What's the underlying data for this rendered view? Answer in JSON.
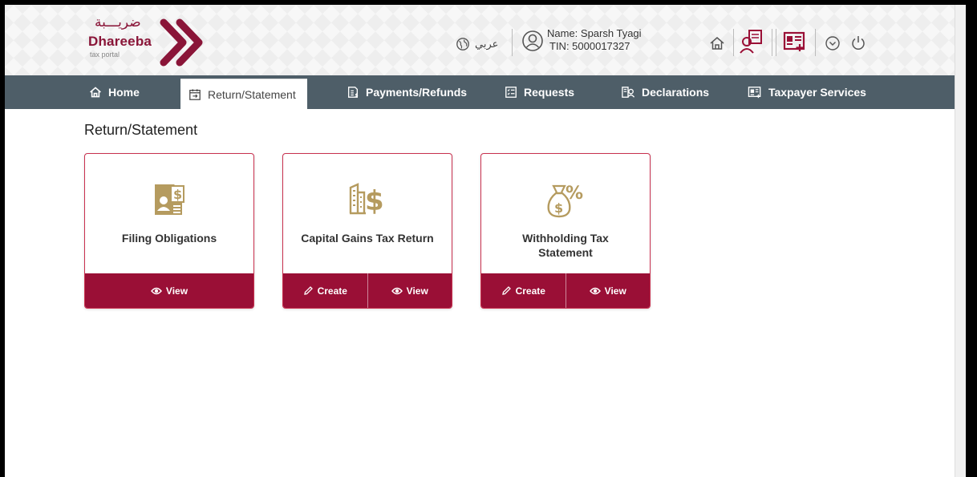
{
  "header": {
    "logo_arabic": "ضريـــبة",
    "logo_name": "Dhareeba",
    "logo_sub": "tax portal",
    "language": "عربي",
    "user_name": "Name: Sparsh Tyagi",
    "user_tin": "TIN: 5000017327",
    "icons": [
      "globe-icon",
      "user-icon",
      "home-icon",
      "account-switch-icon",
      "id-card-add-icon",
      "chevron-down-icon",
      "power-icon"
    ],
    "brand_color": "#8a1538"
  },
  "nav": {
    "items": [
      {
        "label": "Home",
        "icon": "home-icon"
      },
      {
        "label": "Return/Statement",
        "icon": "calendar-return-icon",
        "active": true
      },
      {
        "label": "Payments/Refunds",
        "icon": "payments-icon"
      },
      {
        "label": "Requests",
        "icon": "checklist-icon"
      },
      {
        "label": "Declarations",
        "icon": "declarations-icon"
      },
      {
        "label": "Taxpayer Services",
        "icon": "services-icon"
      }
    ],
    "bg_color": "#4e5e68"
  },
  "page": {
    "title": "Return/Statement"
  },
  "cards": [
    {
      "title": "Filing Obligations",
      "icon": "filing-document-icon",
      "actions": [
        "View"
      ]
    },
    {
      "title": "Capital Gains Tax Return",
      "icon": "building-dollar-icon",
      "actions": [
        "Create",
        "View"
      ]
    },
    {
      "title": "Withholding Tax Statement",
      "icon": "money-bag-percent-icon",
      "actions": [
        "Create",
        "View"
      ]
    }
  ],
  "colors": {
    "card_action_bg": "#9a0f36",
    "card_border": "#c9314f",
    "icon_gold": "#b59b5f"
  }
}
